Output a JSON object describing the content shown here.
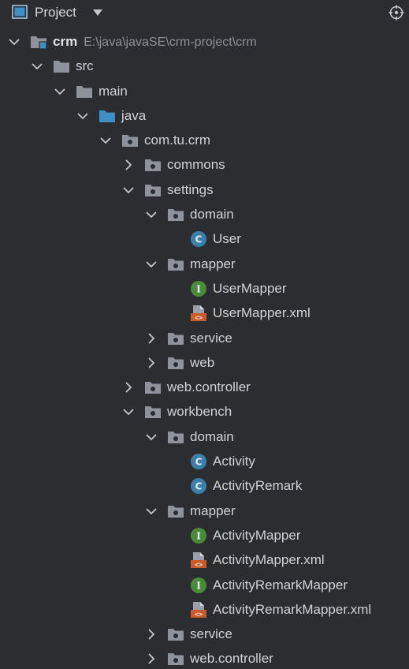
{
  "header": {
    "title": "Project",
    "title_icon": "project-window-icon",
    "dropdown_icon": "caret-down-icon",
    "locate_icon": "crosshair-icon"
  },
  "colors": {
    "background": "#2b2d30",
    "folder": "#8e939b",
    "source_folder": "#3d8fc5",
    "class_badge": "#3b7ea8",
    "interface_badge": "#4a8a3a",
    "xml_badge": "#c75b2a"
  },
  "tree": [
    {
      "level": 0,
      "expanded": true,
      "kind": "module",
      "label": "crm",
      "path": "E:\\java\\javaSE\\crm-project\\crm",
      "name": "tree-item-crm"
    },
    {
      "level": 1,
      "expanded": true,
      "kind": "folder",
      "label": "src",
      "name": "tree-item-src"
    },
    {
      "level": 2,
      "expanded": true,
      "kind": "folder",
      "label": "main",
      "name": "tree-item-main"
    },
    {
      "level": 3,
      "expanded": true,
      "kind": "source-folder",
      "label": "java",
      "name": "tree-item-java"
    },
    {
      "level": 4,
      "expanded": true,
      "kind": "package",
      "label": "com.tu.crm",
      "name": "tree-item-com-tu-crm"
    },
    {
      "level": 5,
      "expanded": false,
      "kind": "package",
      "label": "commons",
      "name": "tree-item-commons"
    },
    {
      "level": 5,
      "expanded": true,
      "kind": "package",
      "label": "settings",
      "name": "tree-item-settings"
    },
    {
      "level": 6,
      "expanded": true,
      "kind": "package",
      "label": "domain",
      "name": "tree-item-settings-domain"
    },
    {
      "level": 7,
      "kind": "class",
      "label": "User",
      "name": "tree-item-user"
    },
    {
      "level": 6,
      "expanded": true,
      "kind": "package",
      "label": "mapper",
      "name": "tree-item-settings-mapper"
    },
    {
      "level": 7,
      "kind": "interface",
      "label": "UserMapper",
      "name": "tree-item-usermapper"
    },
    {
      "level": 7,
      "kind": "xml",
      "label": "UserMapper.xml",
      "name": "tree-item-usermapper-xml"
    },
    {
      "level": 6,
      "expanded": false,
      "kind": "package",
      "label": "service",
      "name": "tree-item-settings-service"
    },
    {
      "level": 6,
      "expanded": false,
      "kind": "package",
      "label": "web",
      "name": "tree-item-settings-web"
    },
    {
      "level": 5,
      "expanded": false,
      "kind": "package",
      "label": "web.controller",
      "name": "tree-item-web-controller"
    },
    {
      "level": 5,
      "expanded": true,
      "kind": "package",
      "label": "workbench",
      "name": "tree-item-workbench"
    },
    {
      "level": 6,
      "expanded": true,
      "kind": "package",
      "label": "domain",
      "name": "tree-item-workbench-domain"
    },
    {
      "level": 7,
      "kind": "class",
      "label": "Activity",
      "name": "tree-item-activity"
    },
    {
      "level": 7,
      "kind": "class",
      "label": "ActivityRemark",
      "name": "tree-item-activityremark"
    },
    {
      "level": 6,
      "expanded": true,
      "kind": "package",
      "label": "mapper",
      "name": "tree-item-workbench-mapper"
    },
    {
      "level": 7,
      "kind": "interface",
      "label": "ActivityMapper",
      "name": "tree-item-activitymapper"
    },
    {
      "level": 7,
      "kind": "xml",
      "label": "ActivityMapper.xml",
      "name": "tree-item-activitymapper-xml"
    },
    {
      "level": 7,
      "kind": "interface",
      "label": "ActivityRemarkMapper",
      "name": "tree-item-activityremarkmapper"
    },
    {
      "level": 7,
      "kind": "xml",
      "label": "ActivityRemarkMapper.xml",
      "name": "tree-item-activityremarkmapper-xml"
    },
    {
      "level": 6,
      "expanded": false,
      "kind": "package",
      "label": "service",
      "name": "tree-item-workbench-service"
    },
    {
      "level": 6,
      "expanded": false,
      "kind": "package",
      "label": "web.controller",
      "name": "tree-item-workbench-web-controller"
    }
  ]
}
